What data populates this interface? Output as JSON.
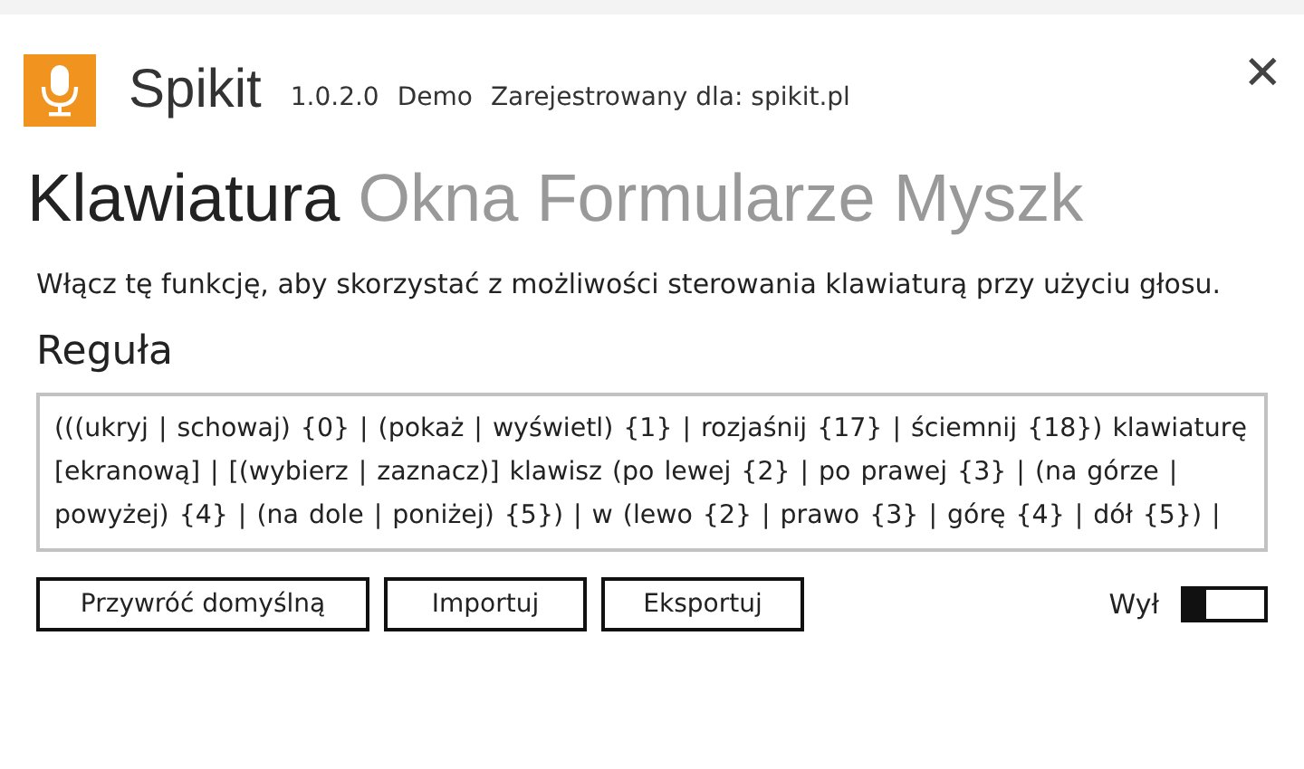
{
  "app": {
    "name": "Spikit",
    "version": "1.0.2.0",
    "edition": "Demo",
    "registration": "Zarejestrowany dla: spikit.pl",
    "close": "✕"
  },
  "tabs": [
    {
      "label": "Klawiatura",
      "selected": true
    },
    {
      "label": "Okna",
      "selected": false
    },
    {
      "label": "Formularze",
      "selected": false
    },
    {
      "label": "Myszk",
      "selected": false
    }
  ],
  "description": "Włącz tę funkcję, aby skorzystać z możliwości sterowania klawiaturą przy użyciu głosu.",
  "rule": {
    "heading": "Reguła",
    "value": "(((ukryj | schowaj) {0} | (pokaż | wyświetl) {1} | rozjaśnij {17} | ściemnij {18}) klawiaturę [ekranową] | [(wybierz | zaznacz)] klawisz (po lewej {2} | po prawej {3} | (na górze | powyżej) {4} | (na dole | poniżej) {5}) | w (lewo {2} | prawo {3} | górę {4} | dół {5}) |"
  },
  "buttons": [
    "Przywróć domyślną",
    "Importuj",
    "Eksportuj"
  ],
  "toggle": {
    "label": "Wył",
    "on": false
  }
}
